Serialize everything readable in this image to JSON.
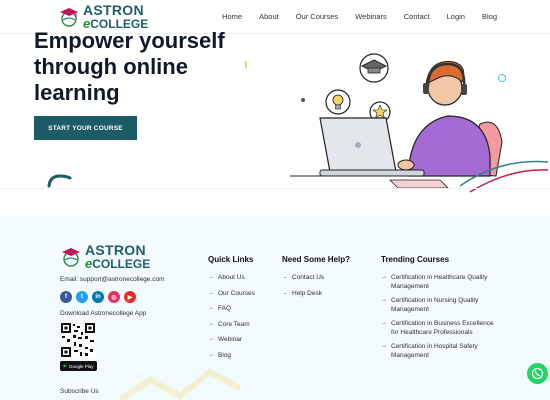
{
  "brand": {
    "line1": "ASTRON",
    "line2_e": "e",
    "line2_rest": "COLLEGE"
  },
  "nav": {
    "links": [
      "Home",
      "About",
      "Our Courses",
      "Webinars",
      "Contact",
      "Login",
      "Blog"
    ]
  },
  "hero": {
    "title": "Empower yourself through online learning",
    "cta_label": "START YOUR COURSE"
  },
  "footer": {
    "email": "Email: support@astronecollege.com",
    "socials": [
      {
        "name": "facebook-icon",
        "glyph": "f",
        "color": "#3b5998"
      },
      {
        "name": "twitter-icon",
        "glyph": "t",
        "color": "#1da1f2"
      },
      {
        "name": "linkedin-icon",
        "glyph": "in",
        "color": "#0077b5"
      },
      {
        "name": "instagram-icon",
        "glyph": "◎",
        "color": "#e1306c"
      },
      {
        "name": "youtube-icon",
        "glyph": "▶",
        "color": "#e52d27"
      }
    ],
    "download_app": "Download Astronecollege App",
    "google_play": "Google Play",
    "subscribe": "Subscribe Us",
    "quick_links": {
      "title": "Quick Links",
      "items": [
        "About Us",
        "Our Courses",
        "FAQ",
        "Core Team",
        "Webinar",
        "Blog"
      ]
    },
    "help": {
      "title": "Need Some Help?",
      "items": [
        "Contact Us",
        "Help Desk"
      ]
    },
    "trending": {
      "title": "Trending Courses",
      "items": [
        "Certification in Healthcare Quality Management",
        "Certification in Nursing Quality Management",
        "Certification in Business Excellence for Healthcare Professionals",
        "Certification in Hospital Safety Management"
      ]
    }
  },
  "colors": {
    "primary": "#1d5b66",
    "footer_bg": "#f2fafb",
    "whatsapp": "#25d366"
  }
}
